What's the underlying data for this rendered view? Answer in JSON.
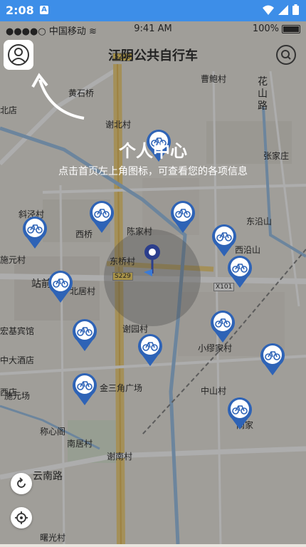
{
  "android_status": {
    "time": "2:08",
    "a_badge": "A"
  },
  "ios_status": {
    "carrier": "中国移动",
    "clock": "9:41 AM",
    "battery": "100%"
  },
  "header": {
    "title": "江阴公共自行车"
  },
  "guide": {
    "title": "个人中心",
    "text": "点击首页左上角图标，可查看您的各项信息"
  },
  "road_tags": [
    "S229",
    "S229",
    "X101"
  ],
  "map_labels": [
    "黄石桥",
    "谢北村",
    "花",
    "山",
    "路",
    "曹鲍村",
    "张家庄",
    "斜泾村",
    "西桥",
    "陈家村",
    "东沿山",
    "西沿山",
    "施元村",
    "东桥村",
    "站前",
    "北居村",
    "宏基宾馆",
    "谢园村",
    "小缪家村",
    "中大酒店",
    "金三角广场",
    "施元场",
    "中山村",
    "称心阁",
    "阚家",
    "南居村",
    "谢南村",
    "云南路",
    "北店",
    "曙光村",
    "西店"
  ],
  "colors": {
    "accent": "#3d8ee8",
    "pin": "#2e63b6",
    "overlay": "rgba(0,0,0,0.32)"
  }
}
